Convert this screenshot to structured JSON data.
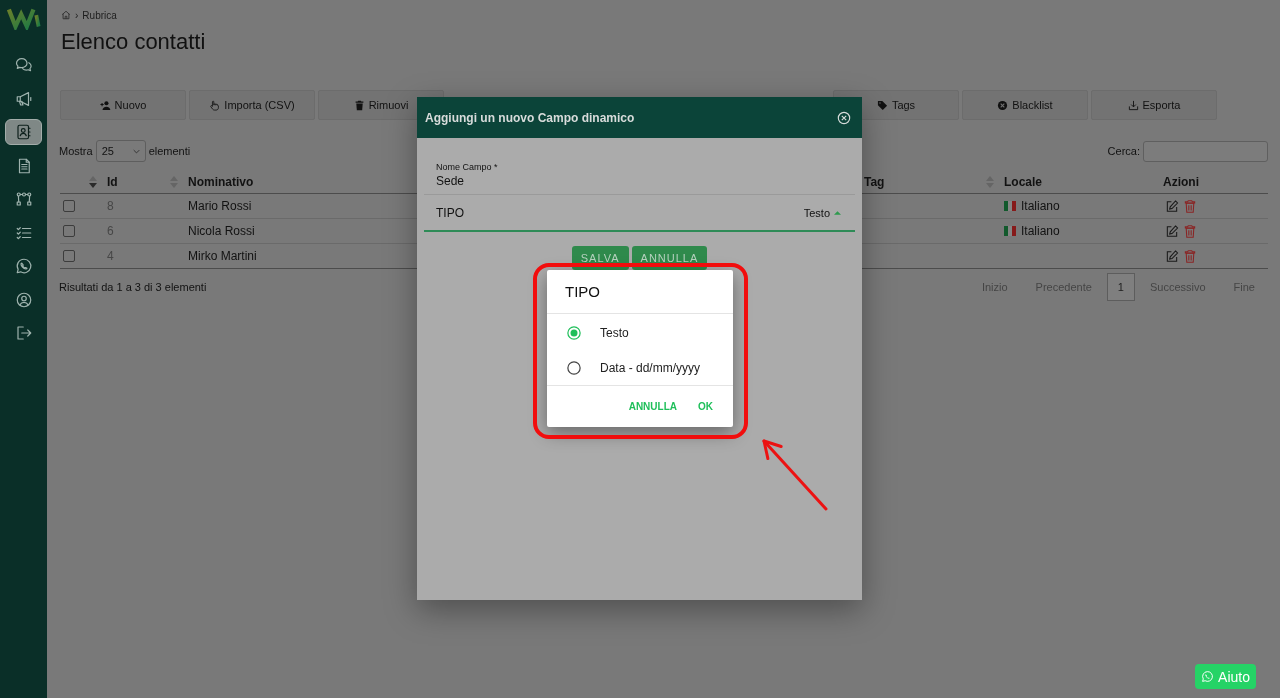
{
  "sidebar": {
    "items": [
      {
        "selected": false
      },
      {
        "selected": false
      },
      {
        "selected": true
      },
      {
        "selected": false
      },
      {
        "selected": false
      },
      {
        "selected": false
      },
      {
        "selected": false
      },
      {
        "selected": false
      },
      {
        "selected": false
      }
    ]
  },
  "breadcrumb": {
    "separator": "›",
    "current": "Rubrica"
  },
  "page_title": "Elenco contatti",
  "toolbar": {
    "left": [
      {
        "label": "Nuovo"
      },
      {
        "label": "Importa (CSV)"
      },
      {
        "label": "Rimuovi"
      }
    ],
    "right": [
      {
        "label": "Tags"
      },
      {
        "label": "Blacklist"
      },
      {
        "label": "Esporta"
      }
    ]
  },
  "table_controls": {
    "length_label": "Mostra",
    "page_size": "25",
    "length_suffix": "elementi",
    "search_label": "Cerca:"
  },
  "table": {
    "columns": [
      {
        "label": "Id",
        "sortable": true,
        "sorted": true
      },
      {
        "label": "Nominativo",
        "sortable": true,
        "sorted": false
      },
      {
        "label": "Tag",
        "sortable": false
      },
      {
        "label": "Locale",
        "sortable": true,
        "sorted": false
      },
      {
        "label": "Azioni",
        "sortable": false
      }
    ],
    "rows": [
      {
        "checked": false,
        "id": "8",
        "name": "Mario Rossi",
        "locale": "Italiano"
      },
      {
        "checked": false,
        "id": "6",
        "name": "Nicola Rossi",
        "locale": "Italiano"
      },
      {
        "checked": false,
        "id": "4",
        "name": "Mirko Martini"
      }
    ]
  },
  "table_info": "Risultati da 1 a 3 di 3 elementi",
  "pagination": [
    {
      "label": "Inizio",
      "selected": false
    },
    {
      "label": "Precedente",
      "selected": false
    },
    {
      "label": "1",
      "selected": true
    },
    {
      "label": "Successivo",
      "selected": false
    },
    {
      "label": "Fine",
      "selected": false
    }
  ],
  "modal": {
    "title": "Aggiungi un nuovo Campo dinamico",
    "name_field": {
      "label": "Nome Campo *",
      "value": "Sede"
    },
    "type_field": {
      "label": "TIPO",
      "value": "Testo",
      "expanded": true
    },
    "buttons": [
      "SALVA",
      "ANNULLA"
    ]
  },
  "picker": {
    "title": "TIPO",
    "options": [
      {
        "label": "Testo",
        "selected": true
      },
      {
        "label": "Data - dd/mm/yyyy",
        "selected": false
      }
    ],
    "buttons": [
      "ANNULLA",
      "OK"
    ]
  },
  "help_button": {
    "label": "Aiuto"
  }
}
